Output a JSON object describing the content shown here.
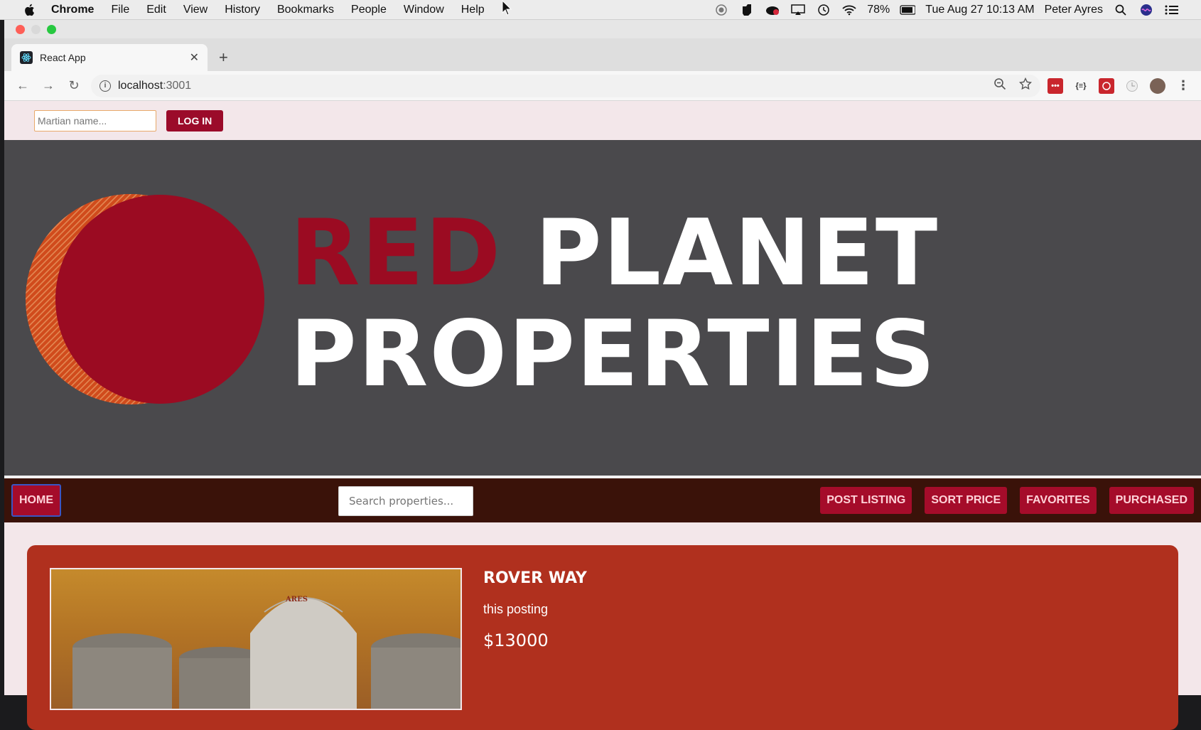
{
  "menubar": {
    "app_name": "Chrome",
    "items": [
      "File",
      "Edit",
      "View",
      "History",
      "Bookmarks",
      "People",
      "Window",
      "Help"
    ],
    "battery": "78%",
    "datetime": "Tue Aug 27  10:13 AM",
    "user": "Peter Ayres"
  },
  "browser": {
    "tab_title": "React App",
    "url_host": "localhost",
    "url_port": ":3001"
  },
  "page": {
    "name_placeholder": "Martian name...",
    "login_label": "LOG IN",
    "hero": {
      "word_red": "RED",
      "word_planet": "PLANET",
      "word_properties": "PROPERTIES"
    },
    "nav": {
      "home": "HOME",
      "search_placeholder": "Search properties...",
      "post_listing": "POST LISTING",
      "sort_price": "SORT PRICE",
      "favorites": "FAVORITES",
      "purchased": "PURCHASED"
    },
    "listing": {
      "title": "ROVER WAY",
      "description": "this posting",
      "price": "$13000",
      "image_text": "ARES"
    }
  },
  "colors": {
    "accent_red": "#9b0b2a",
    "hero_bg": "#4a494c",
    "nav_bg": "#3a1209",
    "card_bg": "#b0301e"
  }
}
